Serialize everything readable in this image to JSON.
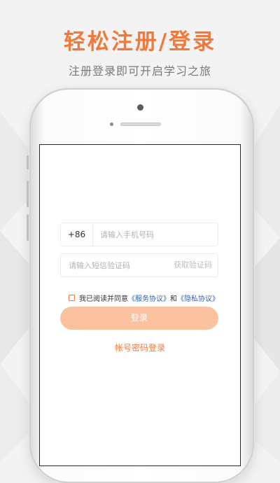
{
  "header": {
    "title": "轻松注册/登录",
    "subtitle": "注册登录即可开启学习之旅"
  },
  "login_form": {
    "country_code": "+86",
    "phone_placeholder": "请输入手机号码",
    "code_placeholder": "请输入短信验证码",
    "get_code_label": "获取验证码",
    "agree_prefix": "我已阅读并同意",
    "service_agreement": "《服务协议》",
    "and_text": "和",
    "privacy_agreement": "《隐私协议》",
    "login_label": "登录",
    "password_login_label": "帐号密码登录"
  },
  "colors": {
    "accent": "#f07a3c",
    "button_disabled": "#fbc29f",
    "link": "#2f63b3"
  }
}
